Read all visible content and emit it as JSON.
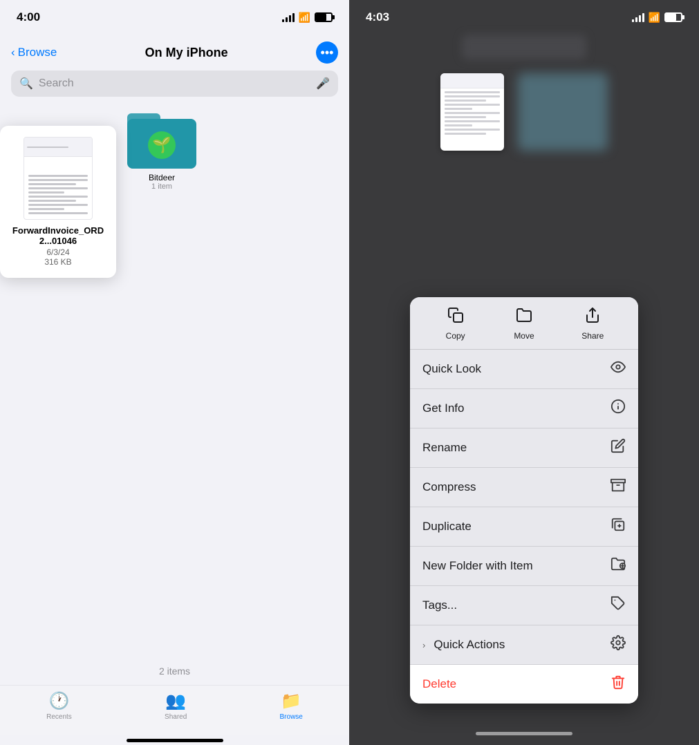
{
  "left": {
    "status": {
      "time": "4:00"
    },
    "nav": {
      "back_label": "Browse",
      "title": "On My iPhone",
      "more_icon": "···"
    },
    "search": {
      "placeholder": "Search"
    },
    "file_tooltip": {
      "name": "ForwardInvoice_ORD2...01046",
      "date": "6/3/24",
      "size": "316 KB"
    },
    "folder": {
      "name": "Bitdeer",
      "items": "1 item",
      "logo": "🌱"
    },
    "bottom": {
      "items_count": "2 items"
    },
    "tabs": [
      {
        "id": "recents",
        "label": "Recents",
        "icon": "🕐",
        "active": false
      },
      {
        "id": "shared",
        "label": "Shared",
        "icon": "👥",
        "active": false
      },
      {
        "id": "browse",
        "label": "Browse",
        "icon": "📁",
        "active": true
      }
    ]
  },
  "right": {
    "status": {
      "time": "4:03"
    },
    "context_menu": {
      "actions": [
        {
          "id": "copy",
          "label": "Copy",
          "icon": "copy"
        },
        {
          "id": "move",
          "label": "Move",
          "icon": "move"
        },
        {
          "id": "share",
          "label": "Share",
          "icon": "share"
        }
      ],
      "menu_items": [
        {
          "id": "quick-look",
          "label": "Quick Look",
          "icon": "eye",
          "chevron": false
        },
        {
          "id": "get-info",
          "label": "Get Info",
          "icon": "info-circle",
          "chevron": false
        },
        {
          "id": "rename",
          "label": "Rename",
          "icon": "pencil",
          "chevron": false
        },
        {
          "id": "compress",
          "label": "Compress",
          "icon": "archive-box",
          "chevron": false
        },
        {
          "id": "duplicate",
          "label": "Duplicate",
          "icon": "duplicate",
          "chevron": false
        },
        {
          "id": "new-folder-with-item",
          "label": "New Folder with Item",
          "icon": "folder-badge-plus",
          "chevron": false
        },
        {
          "id": "tags",
          "label": "Tags...",
          "icon": "tag",
          "chevron": false
        },
        {
          "id": "quick-actions",
          "label": "Quick Actions",
          "icon": "gear",
          "chevron": true
        }
      ],
      "delete": {
        "label": "Delete",
        "icon": "trash"
      }
    }
  }
}
